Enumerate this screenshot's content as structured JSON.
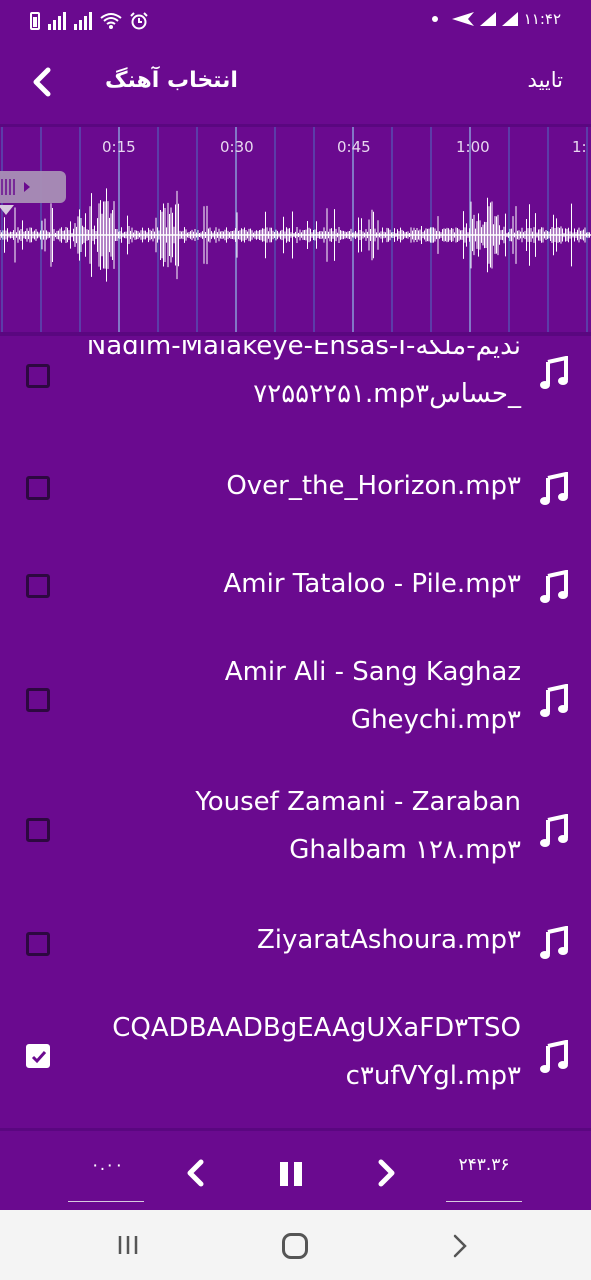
{
  "status_bar": {
    "time": "۱۱:۴۲"
  },
  "header": {
    "title": "انتخاب آهنگ",
    "confirm_label": "تایید"
  },
  "waveform": {
    "time_marks": [
      "0:15",
      "0:30",
      "0:45",
      "1:00",
      "1:"
    ]
  },
  "songs": [
    {
      "line1": "Nadim-Malakeye-Ehsas-I-نديم-ملكه",
      "line2": "۷۲۵۵۲۲۵۱.mp۳حساس_",
      "checked": false
    },
    {
      "line1": "Over_the_Horizon.mp۳",
      "line2": "",
      "checked": false
    },
    {
      "line1": "Amir Tataloo - Pile.mp۳",
      "line2": "",
      "checked": false
    },
    {
      "line1": "Amir Ali - Sang Kaghaz",
      "line2": "Gheychi.mp۳",
      "checked": false
    },
    {
      "line1": "Yousef Zamani - Zaraban",
      "line2": "Ghalbam ۱۲۸.mp۳",
      "checked": false
    },
    {
      "line1": "ZiyaratAshoura.mp۳",
      "line2": "",
      "checked": false
    },
    {
      "line1": "CQADBAADBgEAAgUXaFD۳TSO",
      "line2": "c۳ufVYgl.mp۳",
      "checked": true
    }
  ],
  "footer": {
    "start_time": "۰.۰۰",
    "end_time": "۲۴۳.۳۶"
  },
  "colors": {
    "background": "#6a0a8f",
    "text": "#ffffff",
    "checkbox_border": "#2d0840",
    "navbar": "#f4f4f4"
  },
  "icons": [
    "back-icon",
    "music-note-icon",
    "checkbox-icon",
    "chevron-left-icon",
    "pause-icon",
    "chevron-right-icon",
    "recent-apps-icon",
    "home-icon",
    "nav-back-icon"
  ]
}
